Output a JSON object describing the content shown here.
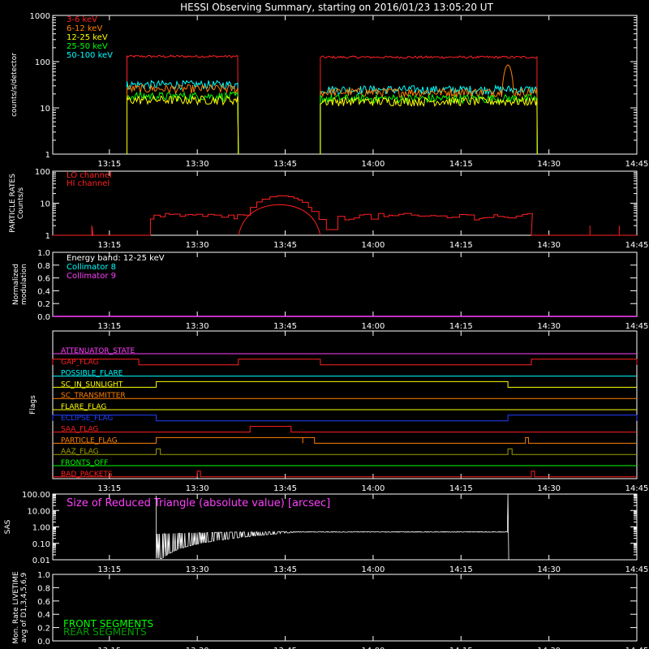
{
  "title": "HESSI Observing Summary, starting on 2016/01/23 13:05:20 UT",
  "time_ticks": [
    "13:15",
    "13:30",
    "13:45",
    "14:00",
    "14:15",
    "14:30",
    "14:45"
  ],
  "colors": {
    "red": "#ff2020",
    "orange": "#ff8000",
    "yellow": "#ffff00",
    "green": "#00ff00",
    "cyan": "#00ffff",
    "magenta": "#ff40ff",
    "blue": "#2040ff",
    "olive": "#a0a000",
    "white": "#ffffff"
  },
  "chart_data": [
    {
      "type": "line",
      "panel": "count_rates",
      "ylabel": "counts/s/detector",
      "yscale": "log",
      "ylim": [
        1,
        1000
      ],
      "y_ticks": [
        "1000",
        "100",
        "10",
        "1"
      ],
      "xlim": [
        "13:05:20",
        "14:45:00"
      ],
      "series": [
        {
          "name": "3-6 keV",
          "color": "red",
          "intervals": [
            [
              "13:18",
              "13:37",
              130
            ],
            [
              "13:51",
              "14:28",
              125
            ]
          ]
        },
        {
          "name": "6-12 keV",
          "color": "orange",
          "intervals": [
            [
              "13:18",
              "13:37",
              26
            ],
            [
              "13:51",
              "14:28",
              22
            ]
          ]
        },
        {
          "name": "12-25 keV",
          "color": "yellow",
          "intervals": [
            [
              "13:18",
              "13:37",
              15
            ],
            [
              "13:51",
              "14:28",
              14
            ]
          ]
        },
        {
          "name": "25-50 keV",
          "color": "green",
          "intervals": [
            [
              "13:18",
              "13:37",
              18
            ],
            [
              "13:51",
              "14:28",
              16
            ]
          ]
        },
        {
          "name": "50-100 keV",
          "color": "cyan",
          "intervals": [
            [
              "13:18",
              "13:37",
              32
            ],
            [
              "13:51",
              "14:28",
              25
            ]
          ]
        }
      ],
      "flare_bump": {
        "series": "6-12 keV",
        "start": "14:22",
        "end": "14:24",
        "peak": 85
      }
    },
    {
      "type": "line",
      "panel": "particle_rates",
      "ylabel": "PARTICLE RATES\nCounts/s",
      "yscale": "log",
      "ylim": [
        1,
        100
      ],
      "y_ticks": [
        "100",
        "10",
        "1"
      ],
      "series": [
        {
          "name": "LO channel",
          "color": "red"
        },
        {
          "name": "HI channel",
          "color": "red"
        }
      ],
      "baseline_level": 4,
      "peak_level": 14,
      "peak_time": "13:44"
    },
    {
      "type": "line",
      "panel": "modulation",
      "ylabel": "Normalized\nmodulation",
      "ylim": [
        0,
        1
      ],
      "y_ticks": [
        "1.0",
        "0.8",
        "0.6",
        "0.4",
        "0.2",
        "0.0"
      ],
      "annotation": "Energy band: 12-25 keV",
      "series": [
        {
          "name": "Collimator 8",
          "color": "cyan"
        },
        {
          "name": "Collimator 9",
          "color": "magenta",
          "value": 0
        }
      ]
    },
    {
      "type": "line",
      "panel": "flags",
      "ylabel": "Flags",
      "series": [
        {
          "name": "ATTENUATOR_STATE",
          "color": "magenta"
        },
        {
          "name": "GAP_FLAG",
          "color": "red"
        },
        {
          "name": "POSSIBLE_FLARE",
          "color": "cyan"
        },
        {
          "name": "SC_IN_SUNLIGHT",
          "color": "yellow"
        },
        {
          "name": "SC_TRANSMITTER",
          "color": "orange"
        },
        {
          "name": "FLARE_FLAG",
          "color": "yellow"
        },
        {
          "name": "ECLIPSE_FLAG",
          "color": "blue"
        },
        {
          "name": "SAA_FLAG",
          "color": "red"
        },
        {
          "name": "PARTICLE_FLAG",
          "color": "orange"
        },
        {
          "name": "AAZ_FLAG",
          "color": "olive"
        },
        {
          "name": "FRONTS_OFF",
          "color": "green"
        },
        {
          "name": "BAD_PACKETS",
          "color": "red"
        }
      ]
    },
    {
      "type": "line",
      "panel": "sas",
      "ylabel": "SAS",
      "yscale": "log",
      "ylim": [
        0.01,
        100
      ],
      "y_ticks": [
        "100.00",
        "10.00",
        "1.00",
        "0.10",
        "0.01"
      ],
      "annotation": "Size of Reduced Triangle (absolute value) [arcsec]",
      "series": [
        {
          "name": "Size of Reduced Triangle",
          "color": "white"
        }
      ]
    },
    {
      "type": "line",
      "panel": "livetime",
      "ylabel": "Mon. Rate LIVETIME\navg of D1,3,4,5,6,9",
      "ylim": [
        0,
        1
      ],
      "y_ticks": [
        "1.0",
        "0.8",
        "0.6",
        "0.4",
        "0.2",
        "0.0"
      ],
      "series": [
        {
          "name": "FRONT SEGMENTS",
          "color": "green"
        },
        {
          "name": "REAR SEGMENTS",
          "color": "#00a000"
        }
      ]
    }
  ]
}
